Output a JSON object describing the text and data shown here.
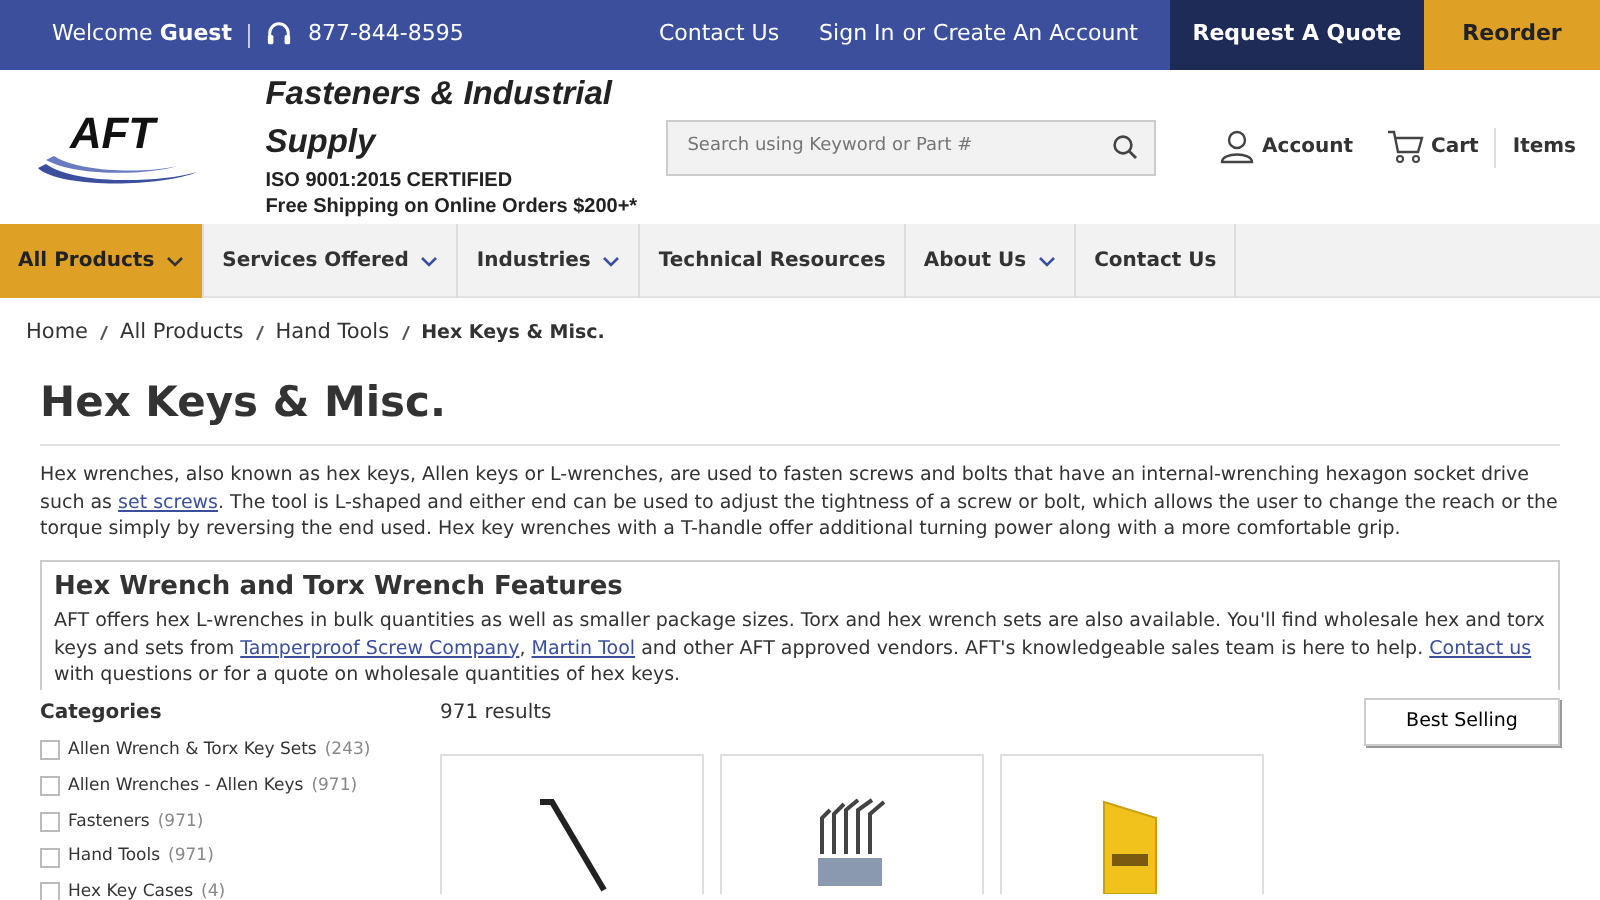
{
  "top_bar": {
    "welcome": "Welcome **Guest**",
    "phone": "877-844-8595",
    "links": [
      "Contact Us",
      "Sign In",
      "or",
      "Create An Account"
    ],
    "quote_button": "Request A Quote",
    "reorder_button": "Reorder"
  },
  "header": {
    "logo_text": "AFT",
    "company": "Fasteners & Industrial Supply",
    "certification": "ISO 9001:2015 CERTIFIED",
    "shipping": "Free Shipping on Online Orders $200+*",
    "search": {
      "placeholder": "Search using Keyword or Part #"
    },
    "account": "Account",
    "cart": "Cart",
    "items": "Items"
  },
  "nav": [
    {
      "label": "All Products",
      "dropdown": true,
      "selected": true
    },
    {
      "label": "Services Offered",
      "dropdown": true,
      "selected": false
    },
    {
      "label": "Industries",
      "dropdown": true,
      "selected": false
    },
    {
      "label": "Technical Resources",
      "dropdown": false,
      "selected": false
    },
    {
      "label": "About Us",
      "dropdown": true,
      "selected": false
    },
    {
      "label": "Contact Us",
      "dropdown": false,
      "selected": false
    }
  ],
  "breadcrumb": [
    "Home",
    "All Products",
    "Hand Tools",
    "Hex Keys & Misc."
  ],
  "title": "Hex Keys & Misc.",
  "intro": {
    "before": "Hex wrenches, also known as hex keys, Allen keys or L-wrenches, are used to fasten screws and bolts that have an internal-wrenching hexagon socket drive such as ",
    "link": "set screws",
    "after": ". The tool is L-shaped and either end can be used to adjust the tightness of a screw or bolt, which allows the user to change the reach or the torque simply by reversing the end used. Hex key wrenches with a T-handle offer additional turning power along with a more comfortable grip."
  },
  "features": {
    "heading": "Hex Wrench and Torx Wrench Features",
    "parts": [
      {
        "kind": "text",
        "text": "AFT offers hex L-wrenches in bulk quantities as well as smaller package sizes. Torx and hex wrench sets are also available. You'll find wholesale hex and torx keys and sets from "
      },
      {
        "kind": "link",
        "text": "Tamperproof Screw Company"
      },
      {
        "kind": "text",
        "text": ", "
      },
      {
        "kind": "link",
        "text": "Martin Tool"
      },
      {
        "kind": "text",
        "text": " and other AFT approved vendors. AFT's knowledgeable sales team is here to help. "
      },
      {
        "kind": "link",
        "text": "Contact us"
      },
      {
        "kind": "text",
        "text": " with questions or for a quote on wholesale quantities of hex keys."
      }
    ]
  },
  "categories": {
    "title": "Categories",
    "items": [
      {
        "label": "Allen Wrench & Torx Key Sets",
        "count": "(243)",
        "checked": false
      },
      {
        "label": "Allen Wrenches - Allen Keys",
        "count": "(971)",
        "checked": false
      },
      {
        "label": "Fasteners",
        "count": "(971)",
        "checked": false
      },
      {
        "label": "Hand Tools",
        "count": "(971)",
        "checked": false
      },
      {
        "label": "Hex Key Cases",
        "count": "(4)",
        "checked": false
      }
    ]
  },
  "results": {
    "count": "971 results",
    "sort": "Best Selling"
  },
  "products": [
    {
      "kind": "lkey"
    },
    {
      "kind": "set"
    },
    {
      "kind": "case"
    }
  ]
}
